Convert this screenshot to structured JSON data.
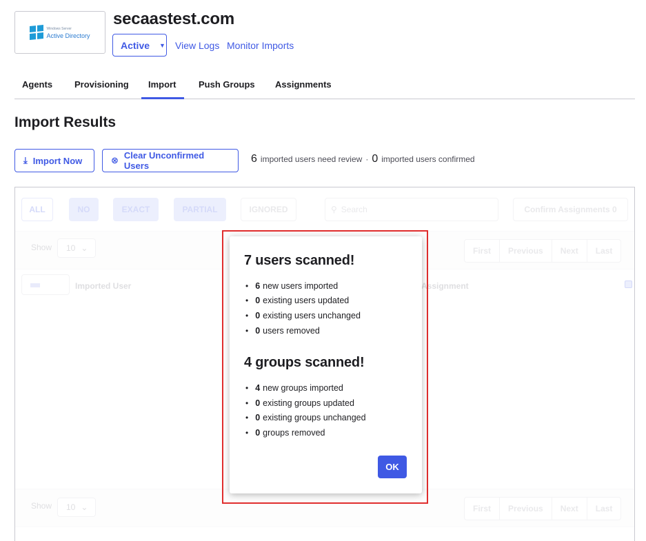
{
  "header": {
    "logo_top": "Windows Server",
    "logo_text": "Active Directory",
    "title": "secaastest.com",
    "status_label": "Active",
    "view_logs": "View Logs",
    "monitor_imports": "Monitor Imports"
  },
  "tabs": [
    {
      "label": "Agents"
    },
    {
      "label": "Provisioning"
    },
    {
      "label": "Import",
      "active": true
    },
    {
      "label": "Push Groups"
    },
    {
      "label": "Assignments"
    }
  ],
  "section_title": "Import Results",
  "actions": {
    "import_now": "Import Now",
    "clear_unconfirmed": "Clear Unconfirmed Users"
  },
  "summary": {
    "need_review_count": "6",
    "need_review_label": "imported users need review",
    "separator": "·",
    "confirmed_count": "0",
    "confirmed_label": "imported users confirmed"
  },
  "table": {
    "filters": [
      "ALL",
      "NO",
      "EXACT",
      "PARTIAL",
      "IGNORED"
    ],
    "search_placeholder": "Search",
    "confirm_label": "Confirm Assignments 0",
    "show_label": "Show",
    "page_size": "10",
    "pager": [
      "First",
      "Previous",
      "Next",
      "Last"
    ],
    "columns": [
      "Imported User",
      "Assignment"
    ]
  },
  "modal": {
    "users_title": "7 users scanned!",
    "users": [
      {
        "count": "6",
        "text": "new users imported"
      },
      {
        "count": "0",
        "text": "existing users updated"
      },
      {
        "count": "0",
        "text": "existing users unchanged"
      },
      {
        "count": "0",
        "text": "users removed"
      }
    ],
    "groups_title": "4 groups scanned!",
    "groups": [
      {
        "count": "4",
        "text": "new groups imported"
      },
      {
        "count": "0",
        "text": "existing groups updated"
      },
      {
        "count": "0",
        "text": "existing groups unchanged"
      },
      {
        "count": "0",
        "text": "groups removed"
      }
    ],
    "ok_label": "OK"
  },
  "colors": {
    "accent": "#3f59e4",
    "highlight": "#e02d2d"
  }
}
